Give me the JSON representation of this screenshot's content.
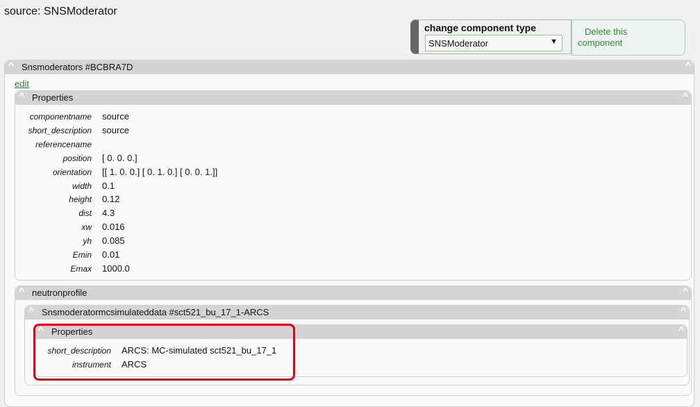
{
  "page": {
    "title": "source: SNSModerator"
  },
  "type_box": {
    "label": "change component type",
    "selected": "SNSModerator",
    "arrow": "▼"
  },
  "delete": {
    "label": "Delete this component"
  },
  "caret": "^",
  "main_panel": {
    "title": "Snsmoderators #BCBRA7D",
    "edit_label": "edit"
  },
  "properties_panel": {
    "title": "Properties",
    "rows": [
      {
        "label": "componentname",
        "value": "source"
      },
      {
        "label": "short_description",
        "value": "source"
      },
      {
        "label": "referencename",
        "value": ""
      },
      {
        "label": "position",
        "value": "[ 0.  0.  0.]"
      },
      {
        "label": "orientation",
        "value": "[[ 1.  0.  0.] [ 0.  1.  0.] [ 0.  0.  1.]]"
      },
      {
        "label": "width",
        "value": "0.1"
      },
      {
        "label": "height",
        "value": "0.12"
      },
      {
        "label": "dist",
        "value": "4.3"
      },
      {
        "label": "xw",
        "value": "0.016"
      },
      {
        "label": "yh",
        "value": "0.085"
      },
      {
        "label": "Emin",
        "value": "0.01"
      },
      {
        "label": "Emax",
        "value": "1000.0"
      }
    ]
  },
  "neutron_panel": {
    "title": "neutronprofile"
  },
  "mcsim_panel": {
    "title": "Snsmoderatormcsimulateddata #sct521_bu_17_1-ARCS"
  },
  "mcsim_properties": {
    "title": "Properties",
    "rows": [
      {
        "label": "short_description",
        "value": "ARCS: MC-simulated sct521_bu_17_1"
      },
      {
        "label": "instrument",
        "value": "ARCS"
      }
    ]
  }
}
